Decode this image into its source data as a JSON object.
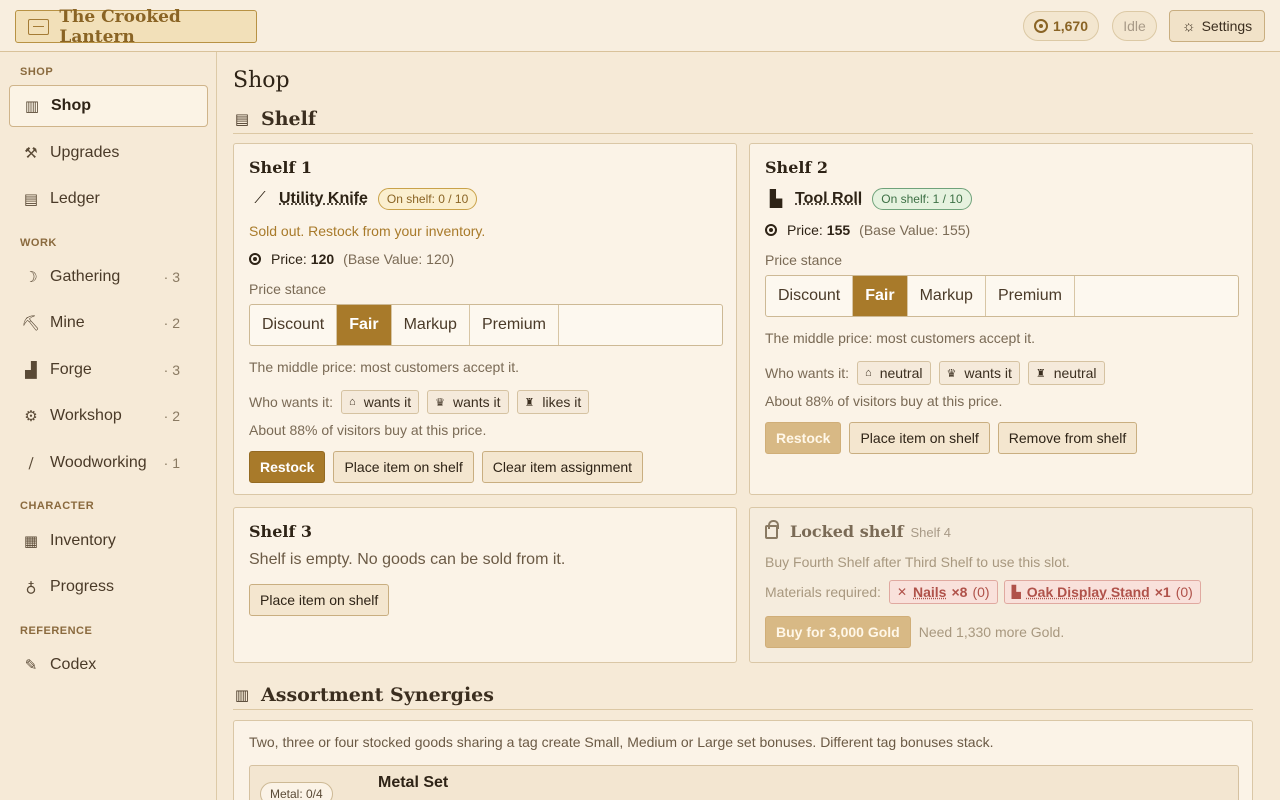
{
  "app": {
    "title": "The Crooked Lantern"
  },
  "topbar": {
    "gold": "1,670",
    "status": "Idle",
    "settings_label": "Settings"
  },
  "sidebar": {
    "sections": [
      {
        "heading": "SHOP",
        "items": [
          {
            "label": "Shop",
            "icon": "shop-icon",
            "count": ""
          }
        ]
      },
      {
        "heading": "",
        "items": [
          {
            "label": "Upgrades",
            "icon": "hammer-icon",
            "count": ""
          },
          {
            "label": "Ledger",
            "icon": "ledger-icon",
            "count": ""
          }
        ]
      },
      {
        "heading": "WORK",
        "items": [
          {
            "label": "Gathering",
            "icon": "sickle-icon",
            "count": "· 3"
          },
          {
            "label": "Mine",
            "icon": "pickaxe-icon",
            "count": "· 2"
          },
          {
            "label": "Forge",
            "icon": "anvil-icon",
            "count": "· 3"
          },
          {
            "label": "Workshop",
            "icon": "saw-icon",
            "count": "· 2"
          },
          {
            "label": "Woodworking",
            "icon": "chisel-icon",
            "count": "· 1"
          }
        ]
      },
      {
        "heading": "CHARACTER",
        "items": [
          {
            "label": "Inventory",
            "icon": "bag-icon",
            "count": ""
          },
          {
            "label": "Progress",
            "icon": "medal-icon",
            "count": ""
          }
        ]
      },
      {
        "heading": "REFERENCE",
        "items": [
          {
            "label": "Codex",
            "icon": "scroll-icon",
            "count": ""
          }
        ]
      }
    ]
  },
  "main": {
    "page_title": "Shop",
    "shelf_section_title": "Shelf",
    "synergy_section_title": "Assortment Synergies",
    "shelves": [
      {
        "title": "Shelf 1",
        "item_name": "Utility Knife",
        "item_icon": "knife-icon",
        "stock_badge": "On shelf: 0 / 10",
        "status_note": "Sold out. Restock from your inventory.",
        "price_label": "Price:",
        "price": "120",
        "base_value": "(Base Value: 120)",
        "stance_label": "Price stance",
        "stances": [
          "Discount",
          "Fair",
          "Markup",
          "Premium"
        ],
        "active_stance": "Fair",
        "stance_desc": "The middle price: most customers accept it.",
        "wants_label": "Who wants it:",
        "wants": [
          {
            "icon": "house-icon",
            "text": "wants it"
          },
          {
            "icon": "crown-icon",
            "text": "wants it"
          },
          {
            "icon": "lantern-icon",
            "text": "likes it"
          }
        ],
        "buy_rate": "About 88% of visitors buy at this price.",
        "buttons": [
          "Restock",
          "Place item on shelf",
          "Clear item assignment"
        ]
      },
      {
        "title": "Shelf 2",
        "item_name": "Tool Roll",
        "item_icon": "toolroll-icon",
        "stock_badge": "On shelf: 1 / 10",
        "price_label": "Price:",
        "price": "155",
        "base_value": "(Base Value: 155)",
        "stance_label": "Price stance",
        "stances": [
          "Discount",
          "Fair",
          "Markup",
          "Premium"
        ],
        "active_stance": "Fair",
        "stance_desc": "The middle price: most customers accept it.",
        "wants_label": "Who wants it:",
        "wants": [
          {
            "icon": "house-icon",
            "text": "neutral"
          },
          {
            "icon": "crown-icon",
            "text": "wants it"
          },
          {
            "icon": "lantern-icon",
            "text": "neutral"
          }
        ],
        "buy_rate": "About 88% of visitors buy at this price.",
        "buttons": [
          "Restock",
          "Place item on shelf",
          "Remove from shelf"
        ]
      },
      {
        "title": "Shelf 3",
        "empty_text": "Shelf is empty. No goods can be sold from it.",
        "button": "Place item on shelf"
      },
      {
        "title": "Locked shelf",
        "subtitle": "Shelf 4",
        "requirement": "Buy Fourth Shelf after Third Shelf to use this slot.",
        "materials_label": "Materials required:",
        "materials": [
          {
            "name": "Nails",
            "qty": "×8",
            "have": "(0)",
            "icon": "nails-icon"
          },
          {
            "name": "Oak Display Stand",
            "qty": "×1",
            "have": "(0)",
            "icon": "stand-icon"
          }
        ],
        "buy_button": "Buy for 3,000 Gold",
        "need_text": "Need 1,330 more Gold."
      }
    ],
    "synergy": {
      "description": "Two, three or four stocked goods sharing a tag create Small, Medium or Large set bonuses. Different tag bonuses stack.",
      "sets": [
        {
          "tag_count": "Metal: 0/4",
          "name": "Metal Set"
        }
      ]
    }
  },
  "colors": {
    "accent": "#a87a2a",
    "background": "#f6ead7",
    "ok": "#3d7045",
    "danger": "#b0524a"
  }
}
